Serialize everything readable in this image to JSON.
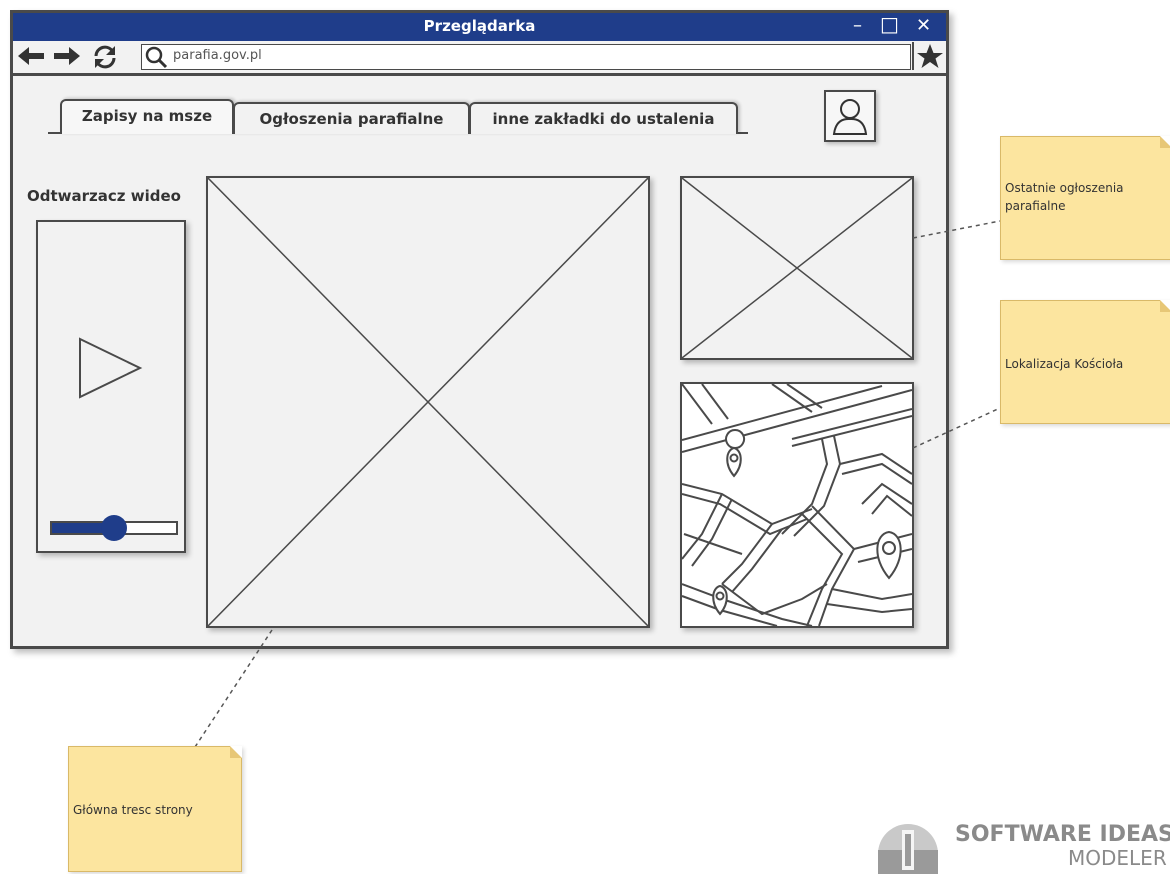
{
  "window": {
    "title": "Przeglądarka",
    "controls": {
      "minimize": "–",
      "maximize": "□",
      "close": "✕"
    }
  },
  "address_bar": {
    "url": "parafia.gov.pl",
    "icons": [
      "back-arrow-icon",
      "forward-arrow-icon",
      "refresh-icon",
      "search-icon",
      "star-icon"
    ]
  },
  "tabs": [
    {
      "label": "Zapisy na msze",
      "active": true
    },
    {
      "label": "Ogłoszenia parafialne",
      "active": false
    },
    {
      "label": "inne zakładki do ustalenia",
      "active": false
    }
  ],
  "user": {
    "icon": "user-icon"
  },
  "video_player": {
    "label": "Odtwarzacz wideo",
    "icon": "play-icon",
    "progress": 0.5
  },
  "notes": {
    "announcements": "Ostatnie ogłoszenia parafialne",
    "location": "Lokalizacja Kościoła",
    "main_content": "Główna tresc strony"
  },
  "watermark": {
    "line1": "SOFTWARE IDEAS",
    "line2": "MODELER"
  },
  "colors": {
    "titlebar": "#1f3d8a",
    "slider": "#1f3d8a",
    "note": "#fce59f",
    "frame": "#4a4a4a",
    "background": "#f2f2f2"
  }
}
